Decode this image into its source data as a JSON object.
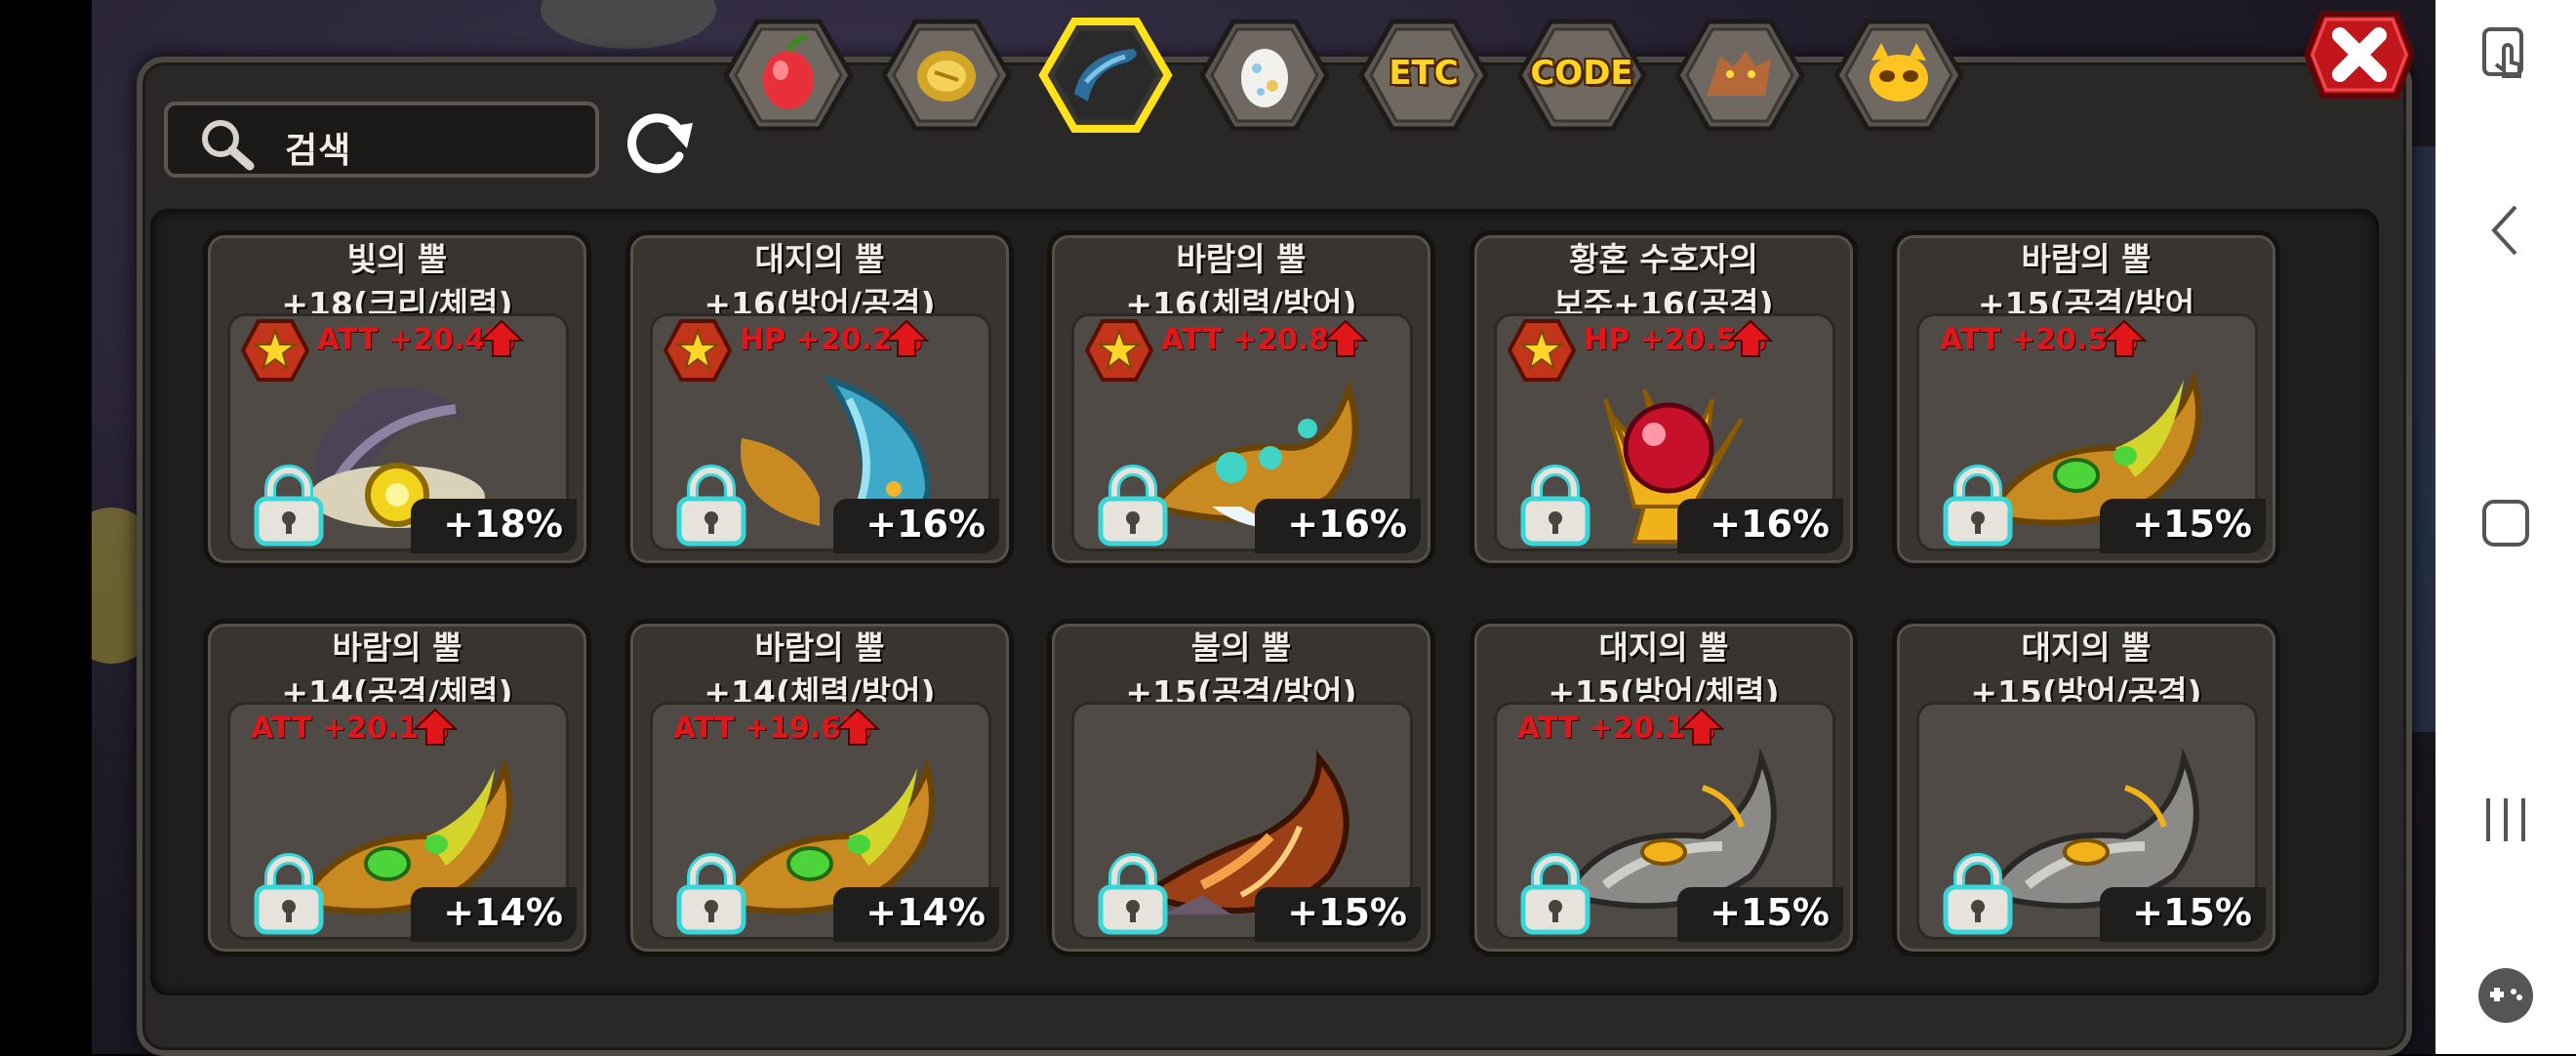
{
  "search": {
    "text": "검색"
  },
  "tabs": [
    {
      "name": "fruit",
      "label": ""
    },
    {
      "name": "coin",
      "label": ""
    },
    {
      "name": "horn",
      "label": "",
      "selected": true
    },
    {
      "name": "egg",
      "label": ""
    },
    {
      "name": "etc",
      "label": "ETC"
    },
    {
      "name": "code",
      "label": "CODE"
    },
    {
      "name": "beast",
      "label": ""
    },
    {
      "name": "mask",
      "label": ""
    }
  ],
  "colors": {
    "bonus_red": "#e0161b",
    "tab_gold": "#ffd321",
    "selected_tab_border": "#ffe21b"
  },
  "items": [
    {
      "title1": "빛의 뿔",
      "title2": "+18(크리/체력)",
      "bonus": "ATT +20.4%",
      "star": true,
      "pct": "+18%",
      "art": "light"
    },
    {
      "title1": "대지의 뿔",
      "title2": "+16(방어/공격)",
      "bonus": "HP +20.2%",
      "star": true,
      "pct": "+16%",
      "art": "earth-blue"
    },
    {
      "title1": "바람의 뿔",
      "title2": "+16(체력/방어)",
      "bonus": "ATT +20.8%",
      "star": true,
      "pct": "+16%",
      "art": "wind-feather"
    },
    {
      "title1": "황혼 수호자의",
      "title2": "보주+16(공격)",
      "bonus": "HP +20.5%",
      "star": true,
      "pct": "+16%",
      "art": "orb"
    },
    {
      "title1": "바람의 뿔",
      "title2": "+15(공격/방어",
      "bonus": "ATT +20.5%",
      "star": false,
      "pct": "+15%",
      "art": "wind"
    },
    {
      "title1": "바람의 뿔",
      "title2": "+14(공격/체력)",
      "bonus": "ATT +20.1%",
      "star": false,
      "pct": "+14%",
      "art": "wind"
    },
    {
      "title1": "바람의 뿔",
      "title2": "+14(체력/방어)",
      "bonus": "ATT +19.6%",
      "star": false,
      "pct": "+14%",
      "art": "wind"
    },
    {
      "title1": "불의 뿔",
      "title2": "+15(공격/방어)",
      "bonus": "",
      "star": false,
      "pct": "+15%",
      "art": "fire"
    },
    {
      "title1": "대지의 뿔",
      "title2": "+15(방어/체력)",
      "bonus": "ATT +20.1%",
      "star": false,
      "pct": "+15%",
      "art": "earth-rock"
    },
    {
      "title1": "대지의 뿔",
      "title2": "+15(방어/공격)",
      "bonus": "",
      "star": false,
      "pct": "+15%",
      "art": "earth-rock"
    }
  ],
  "system_bar": {
    "icons": [
      "touch-assist-icon",
      "back-icon",
      "home-icon",
      "recents-icon",
      "game-tools-icon"
    ]
  }
}
